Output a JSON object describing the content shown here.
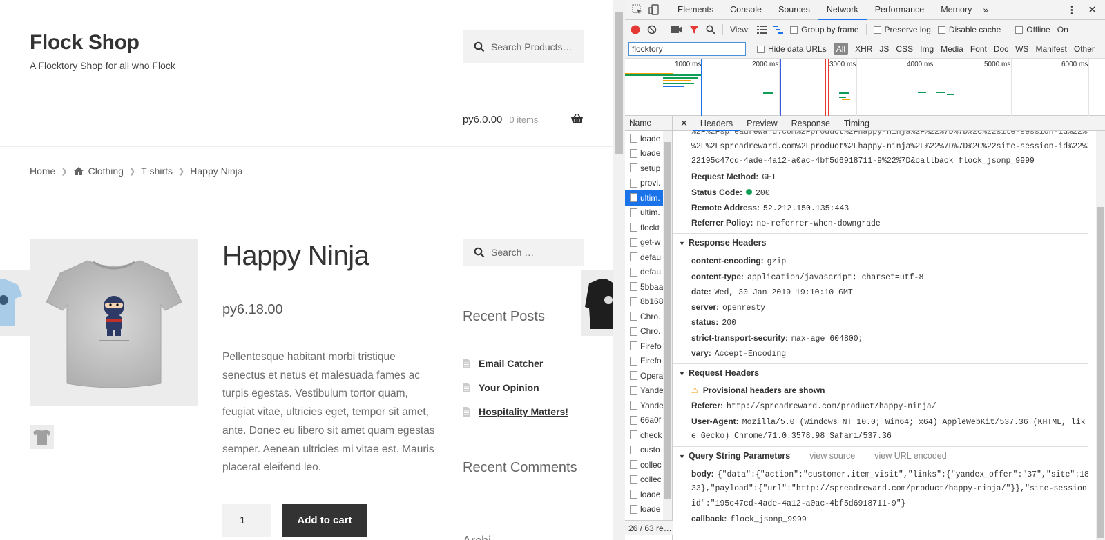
{
  "shop": {
    "title": "Flock Shop",
    "tagline": "A Flocktory Shop for all who Flock",
    "search_placeholder": "Search Products…",
    "cart_amount": "ру6.0.00",
    "cart_items": "0 items",
    "breadcrumb": [
      "Home",
      "Clothing",
      "T-shirts",
      "Happy Ninja"
    ],
    "product": {
      "title": "Happy Ninja",
      "price": "ру6.18.00",
      "description": "Pellentesque habitant morbi tristique senectus et netus et malesuada fames ac turpis egestas. Vestibulum tortor quam, feugiat vitae, ultricies eget, tempor sit amet, ante. Donec eu libero sit amet quam egestas semper. Aenean ultricies mi vitae est. Mauris placerat eleifend leo.",
      "quantity": "1",
      "add_to_cart": "Add to cart"
    },
    "sidebar": {
      "search_placeholder": "Search …",
      "recent_posts_title": "Recent Posts",
      "posts": [
        "Email Catcher",
        "Your Opinion",
        "Hospitality Matters!"
      ],
      "recent_comments_title": "Recent Comments",
      "archives_partial": "Archi…"
    }
  },
  "devtools": {
    "tabs": [
      "Elements",
      "Console",
      "Sources",
      "Network",
      "Performance",
      "Memory"
    ],
    "active_tab": "Network",
    "toolbar": {
      "view_label": "View:",
      "group_by_frame": "Group by frame",
      "preserve_log": "Preserve log",
      "disable_cache": "Disable cache",
      "offline": "Offline",
      "online_partial": "On"
    },
    "filter": {
      "value": "flocktory",
      "hide_data_urls": "Hide data URLs",
      "types": [
        "All",
        "XHR",
        "JS",
        "CSS",
        "Img",
        "Media",
        "Font",
        "Doc",
        "WS",
        "Manifest",
        "Other"
      ]
    },
    "timeline_ticks": [
      "1000 ms",
      "2000 ms",
      "3000 ms",
      "4000 ms",
      "5000 ms",
      "6000 ms"
    ],
    "name_header": "Name",
    "requests": [
      "loade",
      "loade",
      "setup",
      "provi.",
      "ultim.",
      "ultim.",
      "flockt",
      "get-w",
      "defau",
      "defau",
      "5bbaa",
      "8b168",
      "Chro.",
      "Chro.",
      "Firefo",
      "Firefo",
      "Opera",
      "Yande",
      "Yande",
      "66a0f",
      "check",
      "custo",
      "collec",
      "collec",
      "loade",
      "loade"
    ],
    "selected_request_index": 4,
    "footer": "26 / 63 re…",
    "detail_tabs": [
      "Headers",
      "Preview",
      "Response",
      "Timing"
    ],
    "active_detail_tab": "Headers",
    "url_fragment_top": "%2F%2Fspreadreward.com%2Fproduct%2Fhappy-ninja%2F%22%7D%7D%2C%22site-session-id%22%3A%",
    "url_fragment_bottom": "22195c47cd-4ade-4a12-a0ac-4bf5d6918711-9%22%7D&callback=flock_jsonp_9999",
    "general": [
      {
        "k": "Request Method:",
        "v": "GET"
      },
      {
        "k": "Status Code:",
        "v": "200"
      },
      {
        "k": "Remote Address:",
        "v": "52.212.150.135:443"
      },
      {
        "k": "Referrer Policy:",
        "v": "no-referrer-when-downgrade"
      }
    ],
    "response_headers_title": "Response Headers",
    "response_headers": [
      {
        "k": "content-encoding:",
        "v": "gzip"
      },
      {
        "k": "content-type:",
        "v": "application/javascript; charset=utf-8"
      },
      {
        "k": "date:",
        "v": "Wed, 30 Jan 2019 19:10:10 GMT"
      },
      {
        "k": "server:",
        "v": "openresty"
      },
      {
        "k": "status:",
        "v": "200"
      },
      {
        "k": "strict-transport-security:",
        "v": "max-age=604800;"
      },
      {
        "k": "vary:",
        "v": "Accept-Encoding"
      }
    ],
    "request_headers_title": "Request Headers",
    "provisional_warning": "Provisional headers are shown",
    "referer_k": "Referer:",
    "referer_v": "http://spreadreward.com/product/happy-ninja/",
    "ua_k": "User-Agent:",
    "ua_v1": "Mozilla/5.0 (Windows NT 10.0; Win64; x64) AppleWebKit/537.36 (KHTML, lik",
    "ua_v2": "e Gecko) Chrome/71.0.3578.98 Safari/537.36",
    "qsp_title": "Query String Parameters",
    "view_source": "view source",
    "view_url_encoded": "view URL encoded",
    "body_k": "body:",
    "body_v1": "{\"data\":{\"action\":\"customer.item_visit\",\"links\":{\"yandex_offer\":\"37\",\"site\":18",
    "body_v2": "33},\"payload\":{\"url\":\"http://spreadreward.com/product/happy-ninja/\"}},\"site-session-",
    "body_v3": "id\":\"195c47cd-4ade-4a12-a0ac-4bf5d6918711-9\"}",
    "callback_k": "callback:",
    "callback_v": "flock_jsonp_9999",
    "colors": {
      "accent": "#1a73e8",
      "record": "#e53935",
      "status_ok": "#0f9d58"
    }
  }
}
